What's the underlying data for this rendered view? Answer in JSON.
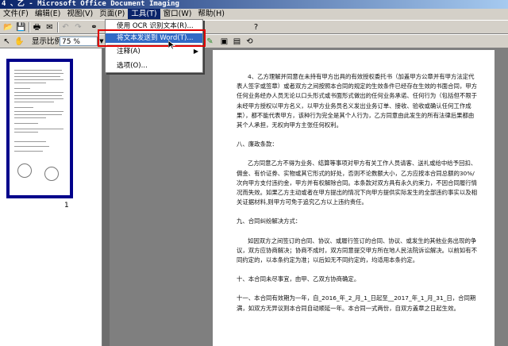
{
  "window": {
    "title": "4 、乙 - Microsoft Office Document Imaging"
  },
  "menubar": {
    "items": [
      "文件(F)",
      "编辑(E)",
      "视图(V)",
      "页面(P)",
      "工具(T)",
      "窗口(W)",
      "帮助(H)"
    ],
    "active_index": 4
  },
  "toolbar": {
    "zoom_label": "显示比例:",
    "zoom_value": "75 %"
  },
  "tools_menu": {
    "items": [
      {
        "label": "使用 OCR 识别文本(R)..."
      },
      {
        "label": "将文本发送到 Word(T)...",
        "highlighted": true
      },
      {
        "label": "注释(A)",
        "has_submenu": true
      },
      {
        "label": "选项(O)..."
      }
    ]
  },
  "thumbnail": {
    "page_number": "1"
  },
  "document": {
    "paragraphs": [
      "4、乙方理解并同意在未持有甲方出具的有效授权委托书（加盖甲方公章并有甲方法定代表人签字或签章）或者双方之间按照本合同的规定的生效条件已经存在生效的书面合同，甲方任何业务经办人员无论以口头形式或书面形式做出的任何业务承诺、任何行为（包括但不限于未经甲方授权以甲方名义，以甲方业务员名义发出业务订单、接收、验收或确认任何工作成果），都不能代表甲方，该种行为完全是其个人行为，乙方同意由此发生的所有法律后果都由其个人承担，无权向甲方主张任何权利。",
      "八、廉政条款：",
      "乙方同意乙方不得为业务、结算等事项对甲方有关工作人员请客、送礼或给中给予回扣、佣金、有价证券、实物或其它形式的好处，否则不论数额大小，乙方应按本合同总额的30%/次向甲方支付违约金，甲方并有权解除合同。本条款对双方具有永久约束力，不因合同履行情况而失效。如果乙方主动或者在甲方提出的情况下向甲方提供实际发生的全部违约事实以及相关证据材料,则甲方可免于追究乙方以上违约责任。",
      "九、合同纠纷解决方式：",
      "如因双方之间签订的合同、协议、或履行签订的合同、协议、或发生的其他业务出现的争议，双方应协商解决；协商不成时，双方同意提交甲方所在地人民法院诉讼解决。以前如有不同约定的，以本条约定为准；以后如无不同约定的，均适用本条约定。",
      "十、本合同未尽事宜，由甲、乙双方协商确定。",
      "十一、本合同有效期为一年，自_2016_年_2_月_1_日起至__2017_年_1_月_31_日，合同期满，如双方无异议则本合同自动顺延一年。本合同一式两份，自双方盖章之日起生效。"
    ]
  }
}
